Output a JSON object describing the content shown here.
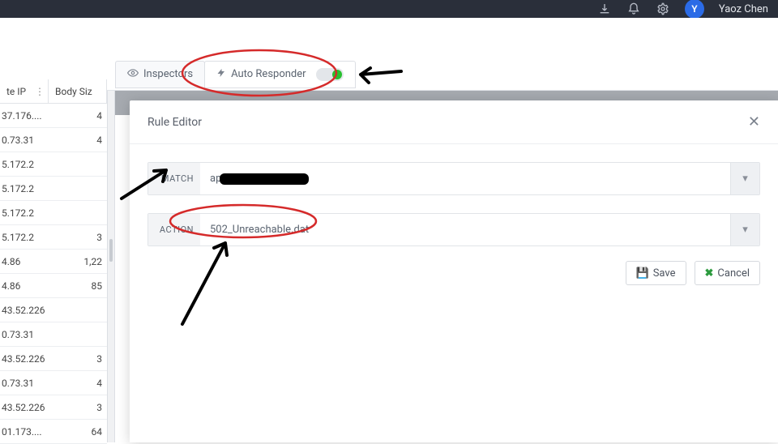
{
  "header": {
    "username": "Yaoz Chen",
    "avatar_initial": "Y"
  },
  "tabs": {
    "inspectors_label": "Inspectors",
    "autoresponder_label": "Auto Responder"
  },
  "table": {
    "col1_header": "te IP",
    "col2_header": "Body Siz",
    "rows": [
      {
        "ip": "37.176....",
        "size": "4"
      },
      {
        "ip": "0.73.31",
        "size": "4"
      },
      {
        "ip": "5.172.2",
        "size": ""
      },
      {
        "ip": "5.172.2",
        "size": ""
      },
      {
        "ip": "5.172.2",
        "size": ""
      },
      {
        "ip": "5.172.2",
        "size": "3"
      },
      {
        "ip": "4.86",
        "size": "1,22"
      },
      {
        "ip": "4.86",
        "size": "85"
      },
      {
        "ip": "43.52.226",
        "size": ""
      },
      {
        "ip": "0.73.31",
        "size": ""
      },
      {
        "ip": "43.52.226",
        "size": "3"
      },
      {
        "ip": "0.73.31",
        "size": "4"
      },
      {
        "ip": "43.52.226",
        "size": "3"
      },
      {
        "ip": "01.173....",
        "size": "64"
      }
    ]
  },
  "rule_editor": {
    "title": "Rule Editor",
    "match_label": "MATCH",
    "match_value_prefix": "ap",
    "action_label": "ACTION",
    "action_value": "502_Unreachable.dat",
    "save_label": "Save",
    "cancel_label": "Cancel"
  }
}
